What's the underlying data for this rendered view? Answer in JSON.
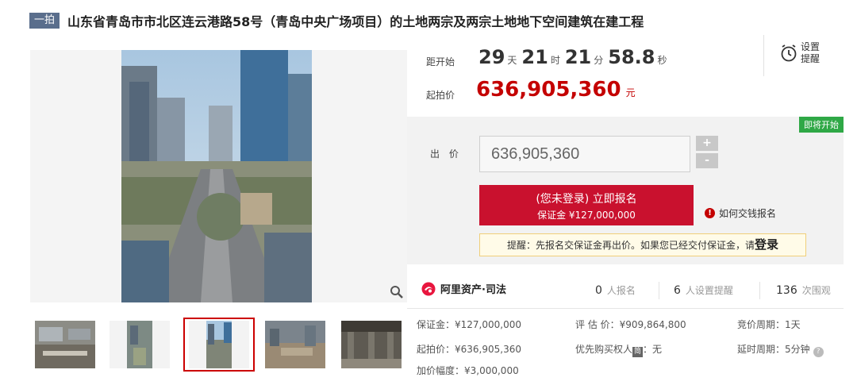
{
  "header": {
    "auction_tag": "一拍",
    "title": "山东省青岛市市北区连云港路58号（青岛中央广场项目）的土地两宗及两宗土地地下空间建筑在建工程"
  },
  "countdown": {
    "label": "距开始",
    "days": "29",
    "days_unit": "天",
    "hours": "21",
    "hours_unit": "时",
    "minutes": "21",
    "minutes_unit": "分",
    "seconds": "58.8",
    "seconds_unit": "秒"
  },
  "start_price": {
    "label": "起拍价",
    "value": "636,905,360",
    "unit": "元"
  },
  "reminder": {
    "label": "设置提醒"
  },
  "bid": {
    "status_badge": "即将开始",
    "label": "出 价",
    "input_value": "636,905,360",
    "plus": "+",
    "minus": "-",
    "signup_line1": "(您未登录) 立即报名",
    "signup_line2": "保证金 ¥127,000,000",
    "howto": "如何交钱报名",
    "notice_text": "提醒：先报名交保证金再出价。如果您已经交付保证金，请",
    "notice_login": "登录"
  },
  "stats": {
    "brand": "阿里资产·司法",
    "signups_num": "0",
    "signups_label": "人报名",
    "reminders_num": "6",
    "reminders_label": "人设置提醒",
    "views_num": "136",
    "views_label": "次围观"
  },
  "details": {
    "deposit": "保证金：¥127,000,000",
    "appraisal": "评 估 价：¥909,864,800",
    "bid_period": "竞价周期：1天",
    "start_price": "起拍价：¥636,905,360",
    "priority_label": "优先购买权人",
    "priority_badge": "简",
    "priority_value": "：无",
    "delay_period": "延时周期：5分钟",
    "increment": "加价幅度：¥3,000,000"
  },
  "gallery": {
    "thumbnail_count": 5,
    "selected_index": 2
  }
}
